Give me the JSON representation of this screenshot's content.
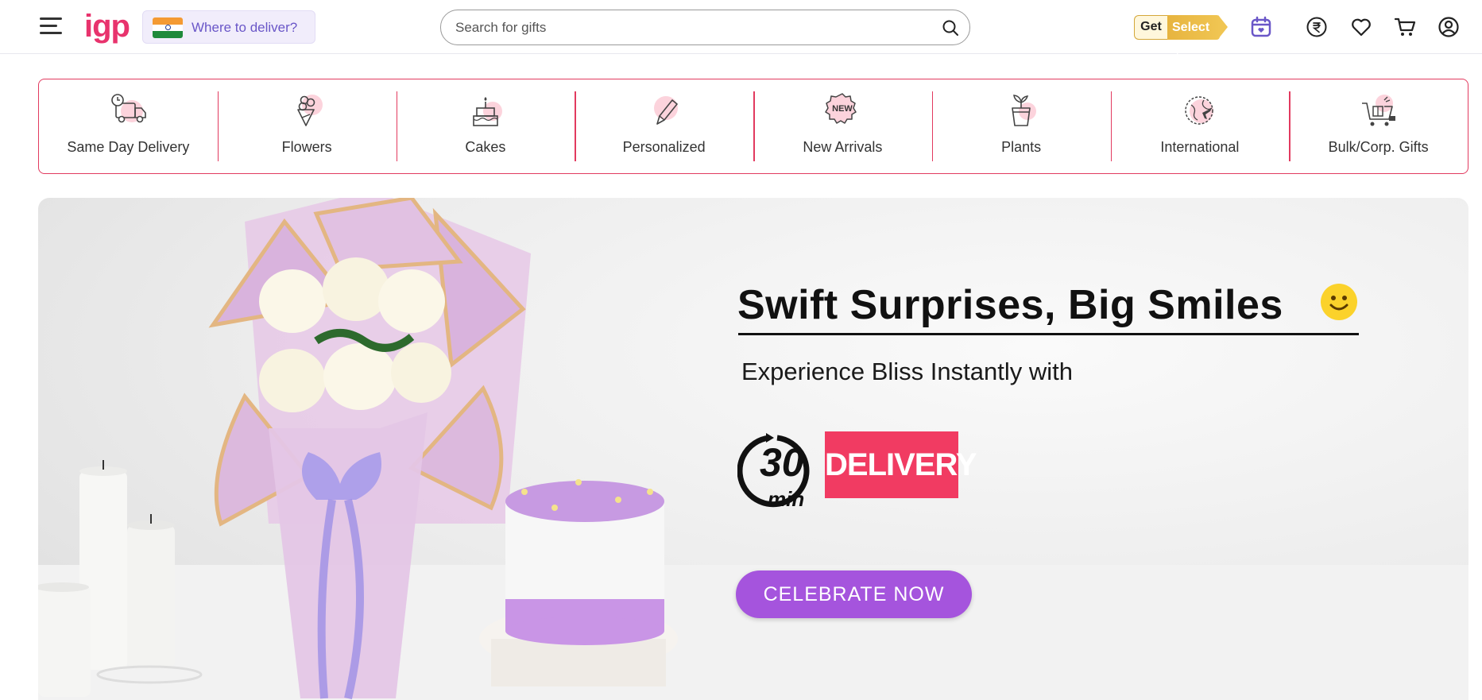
{
  "header": {
    "menu_icon": "hamburger-menu-icon",
    "logo": "igp",
    "deliver": {
      "flag": "india-flag",
      "label": "Where to deliver?"
    },
    "search": {
      "placeholder": "Search for gifts",
      "value": "",
      "icon": "search-icon"
    },
    "get_select": {
      "get": "Get",
      "select": "Select"
    },
    "icons": [
      "calendar-icon",
      "rupee-currency-icon",
      "heart-icon",
      "cart-icon",
      "user-account-icon"
    ]
  },
  "categories": [
    {
      "label": "Same Day Delivery",
      "icon": "delivery-truck-icon"
    },
    {
      "label": "Flowers",
      "icon": "bouquet-icon"
    },
    {
      "label": "Cakes",
      "icon": "cake-icon"
    },
    {
      "label": "Personalized",
      "icon": "pencil-icon"
    },
    {
      "label": "New Arrivals",
      "icon": "new-badge-icon",
      "badge_text": "NEW"
    },
    {
      "label": "Plants",
      "icon": "plant-pot-icon"
    },
    {
      "label": "International",
      "icon": "globe-plane-icon"
    },
    {
      "label": "Bulk/Corp. Gifts",
      "icon": "gift-cart-icon"
    }
  ],
  "hero": {
    "title": "Swift Surprises, Big Smiles",
    "subtitle": "Experience Bliss Instantly with",
    "badge_number": "30",
    "badge_unit": "min",
    "badge_text": "DELIVERY",
    "cta": "CELEBRATE NOW",
    "colors": {
      "accent": "#e8336d",
      "cta": "#a554dd",
      "delivery": "#f13b62"
    }
  }
}
